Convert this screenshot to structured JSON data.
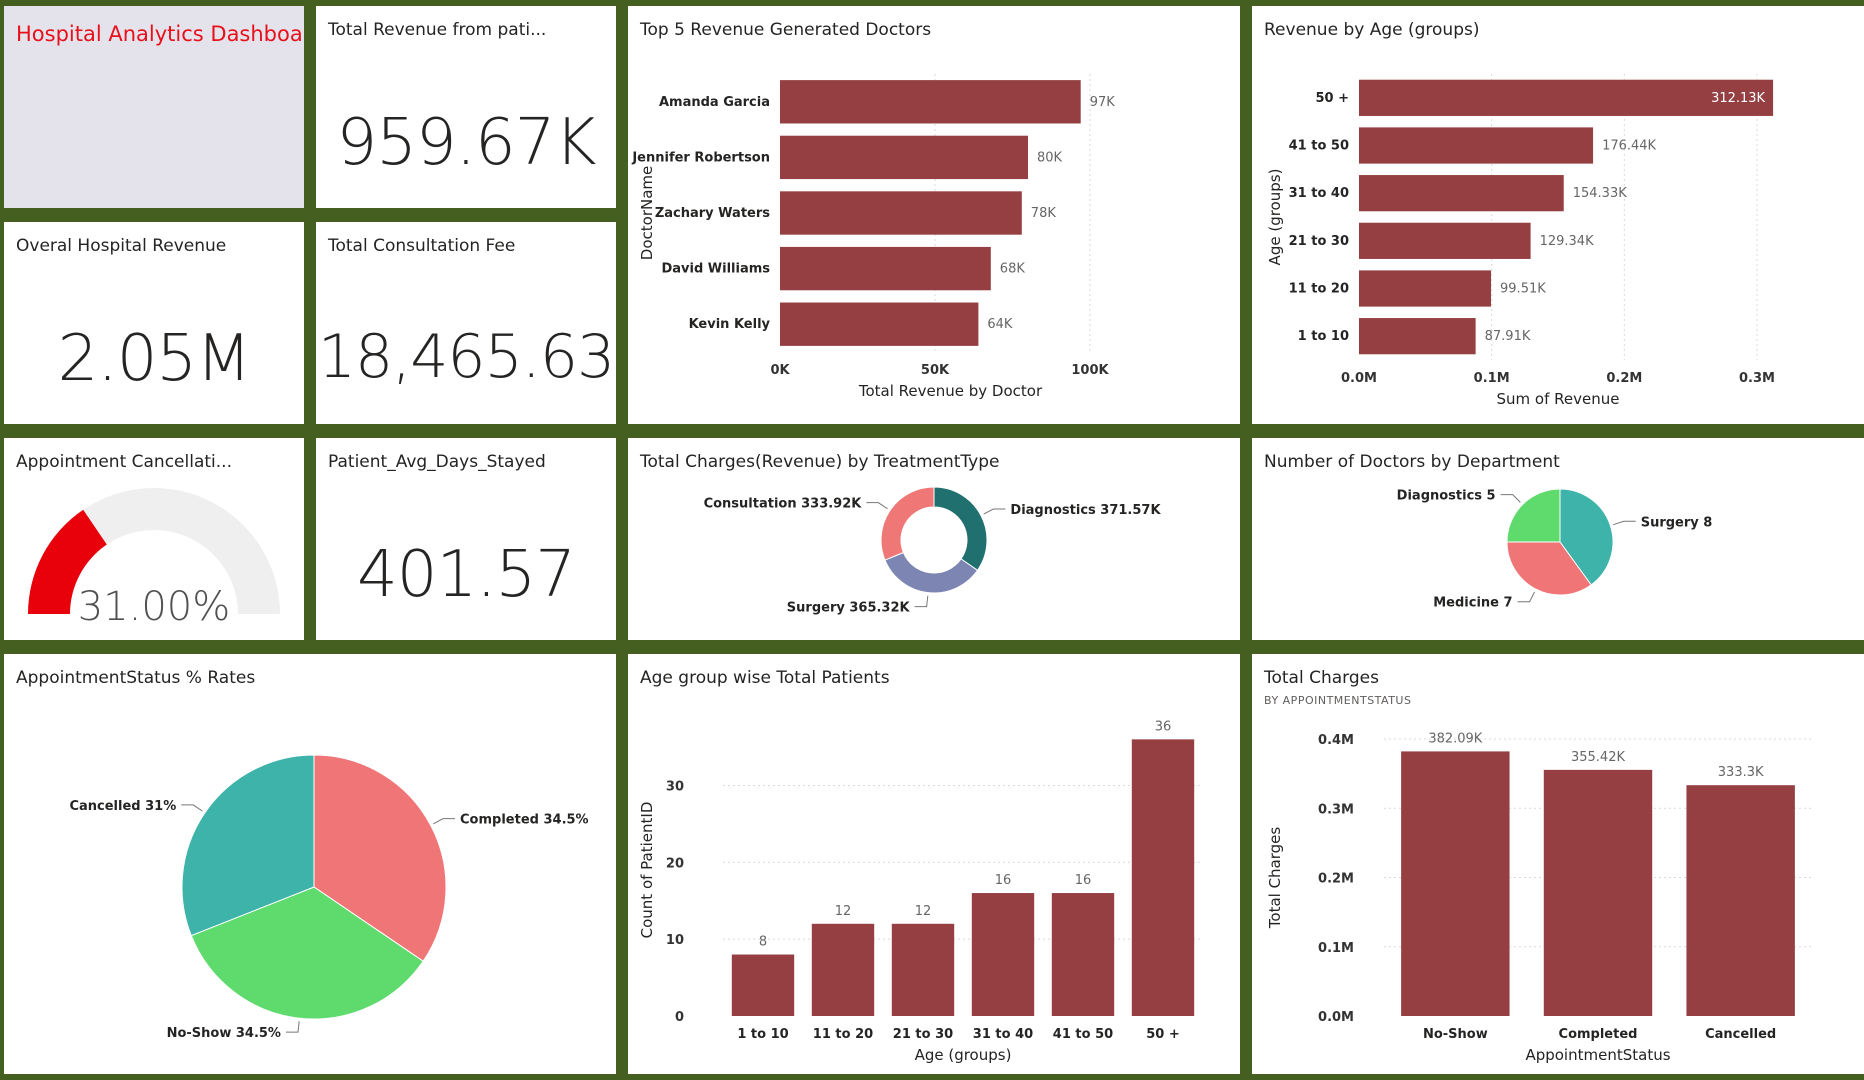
{
  "dashboard": {
    "title": "Hospital Analytics Dashboard",
    "colors": {
      "frame": "#455f20",
      "bar": "#953f43",
      "title_red": "#e8101a",
      "title_bg": "#e4e3ec"
    }
  },
  "cards": {
    "total_revenue_patients": {
      "title": "Total Revenue from pati...",
      "value": "959.67K"
    },
    "overall_revenue": {
      "title": "Overal Hospital Revenue",
      "value": "2.05M"
    },
    "consultation_fee": {
      "title": "Total Consultation Fee",
      "value": "18,465.63"
    },
    "avg_days": {
      "title": "Patient_Avg_Days_Stayed",
      "value": "401.57"
    }
  },
  "gauge": {
    "title": "Appointment Cancellati...",
    "value": 0.31,
    "label": "31.00%",
    "color": "#e8000b",
    "track": "#f0efef"
  },
  "chart_data": [
    {
      "id": "top_doctors",
      "type": "bar",
      "orientation": "horizontal",
      "title": "Top 5 Revenue Generated Doctors",
      "xlabel": "Total Revenue by Doctor",
      "ylabel": "DoctorName",
      "categories": [
        "Amanda Garcia",
        "Jennifer Robertson",
        "Zachary Waters",
        "David Williams",
        "Kevin Kelly"
      ],
      "values": [
        97000,
        80000,
        78000,
        68000,
        64000
      ],
      "data_labels": [
        "97K",
        "80K",
        "78K",
        "68K",
        "64K"
      ],
      "xlim": [
        0,
        110000
      ],
      "ticks": [
        0,
        50000,
        100000
      ],
      "tick_labels": [
        "0K",
        "50K",
        "100K"
      ],
      "grid": true
    },
    {
      "id": "age_revenue",
      "type": "bar",
      "orientation": "horizontal",
      "title": "Revenue by Age (groups)",
      "xlabel": "Sum of Revenue",
      "ylabel": "Age (groups)",
      "categories": [
        "50 +",
        "41 to 50",
        "31 to 40",
        "21 to 30",
        "11 to 20",
        "1 to 10"
      ],
      "values": [
        312130,
        176440,
        154330,
        129340,
        99510,
        87910
      ],
      "data_labels": [
        "312.13K",
        "176.44K",
        "154.33K",
        "129.34K",
        "99.51K",
        "87.91K"
      ],
      "xlim": [
        0,
        300000
      ],
      "ticks": [
        0,
        100000,
        200000,
        300000
      ],
      "tick_labels": [
        "0.0M",
        "0.1M",
        "0.2M",
        "0.3M"
      ],
      "grid": true
    },
    {
      "id": "treatment_type",
      "type": "pie",
      "donut": true,
      "title": "Total Charges(Revenue) by TreatmentType",
      "series": [
        {
          "name": "Diagnostics",
          "value": 371570,
          "label": "Diagnostics 371.57K",
          "color": "#207070"
        },
        {
          "name": "Surgery",
          "value": 365320,
          "label": "Surgery 365.32K",
          "color": "#7d85b2"
        },
        {
          "name": "Consultation",
          "value": 333920,
          "label": "Consultation 333.92K",
          "color": "#ef7877"
        }
      ]
    },
    {
      "id": "doctors_department",
      "type": "pie",
      "title": "Number of Doctors by Department",
      "series": [
        {
          "name": "Surgery",
          "value": 8,
          "label": "Surgery 8",
          "color": "#3db3aa"
        },
        {
          "name": "Medicine",
          "value": 7,
          "label": "Medicine 7",
          "color": "#f07577"
        },
        {
          "name": "Diagnostics",
          "value": 5,
          "label": "Diagnostics 5",
          "color": "#5fdb6e"
        }
      ]
    },
    {
      "id": "appointment_status",
      "type": "pie",
      "title": "AppointmentStatus % Rates",
      "series": [
        {
          "name": "Completed",
          "value": 34.5,
          "label": "Completed 34.5%",
          "color": "#f07577"
        },
        {
          "name": "No-Show",
          "value": 34.5,
          "label": "No-Show 34.5%",
          "color": "#5fdb6e"
        },
        {
          "name": "Cancelled",
          "value": 31,
          "label": "Cancelled 31%",
          "color": "#3db3aa"
        }
      ]
    },
    {
      "id": "age_patients",
      "type": "bar",
      "orientation": "vertical",
      "title": "Age group wise Total Patients",
      "xlabel": "Age (groups)",
      "ylabel": "Count of PatientID",
      "categories": [
        "1 to 10",
        "11 to 20",
        "21 to 30",
        "31 to 40",
        "41 to 50",
        "50 +"
      ],
      "values": [
        8,
        12,
        12,
        16,
        16,
        36
      ],
      "data_labels": [
        "8",
        "12",
        "12",
        "16",
        "16",
        "36"
      ],
      "ylim": [
        0,
        38
      ],
      "ticks": [
        0,
        10,
        20,
        30
      ],
      "tick_labels": [
        "0",
        "10",
        "20",
        "30"
      ],
      "grid": true
    },
    {
      "id": "status_charges",
      "type": "bar",
      "orientation": "vertical",
      "title": "Total Charges",
      "subtitle": "BY APPOINTMENTSTATUS",
      "xlabel": "AppointmentStatus",
      "ylabel": "Total Charges",
      "categories": [
        "No-Show",
        "Completed",
        "Cancelled"
      ],
      "values": [
        382090,
        355420,
        333300
      ],
      "data_labels": [
        "382.09K",
        "355.42K",
        "333.3K"
      ],
      "ylim": [
        0,
        400000
      ],
      "ticks": [
        0,
        100000,
        200000,
        300000,
        400000
      ],
      "tick_labels": [
        "0.0M",
        "0.1M",
        "0.2M",
        "0.3M",
        "0.4M"
      ],
      "grid": true
    }
  ]
}
